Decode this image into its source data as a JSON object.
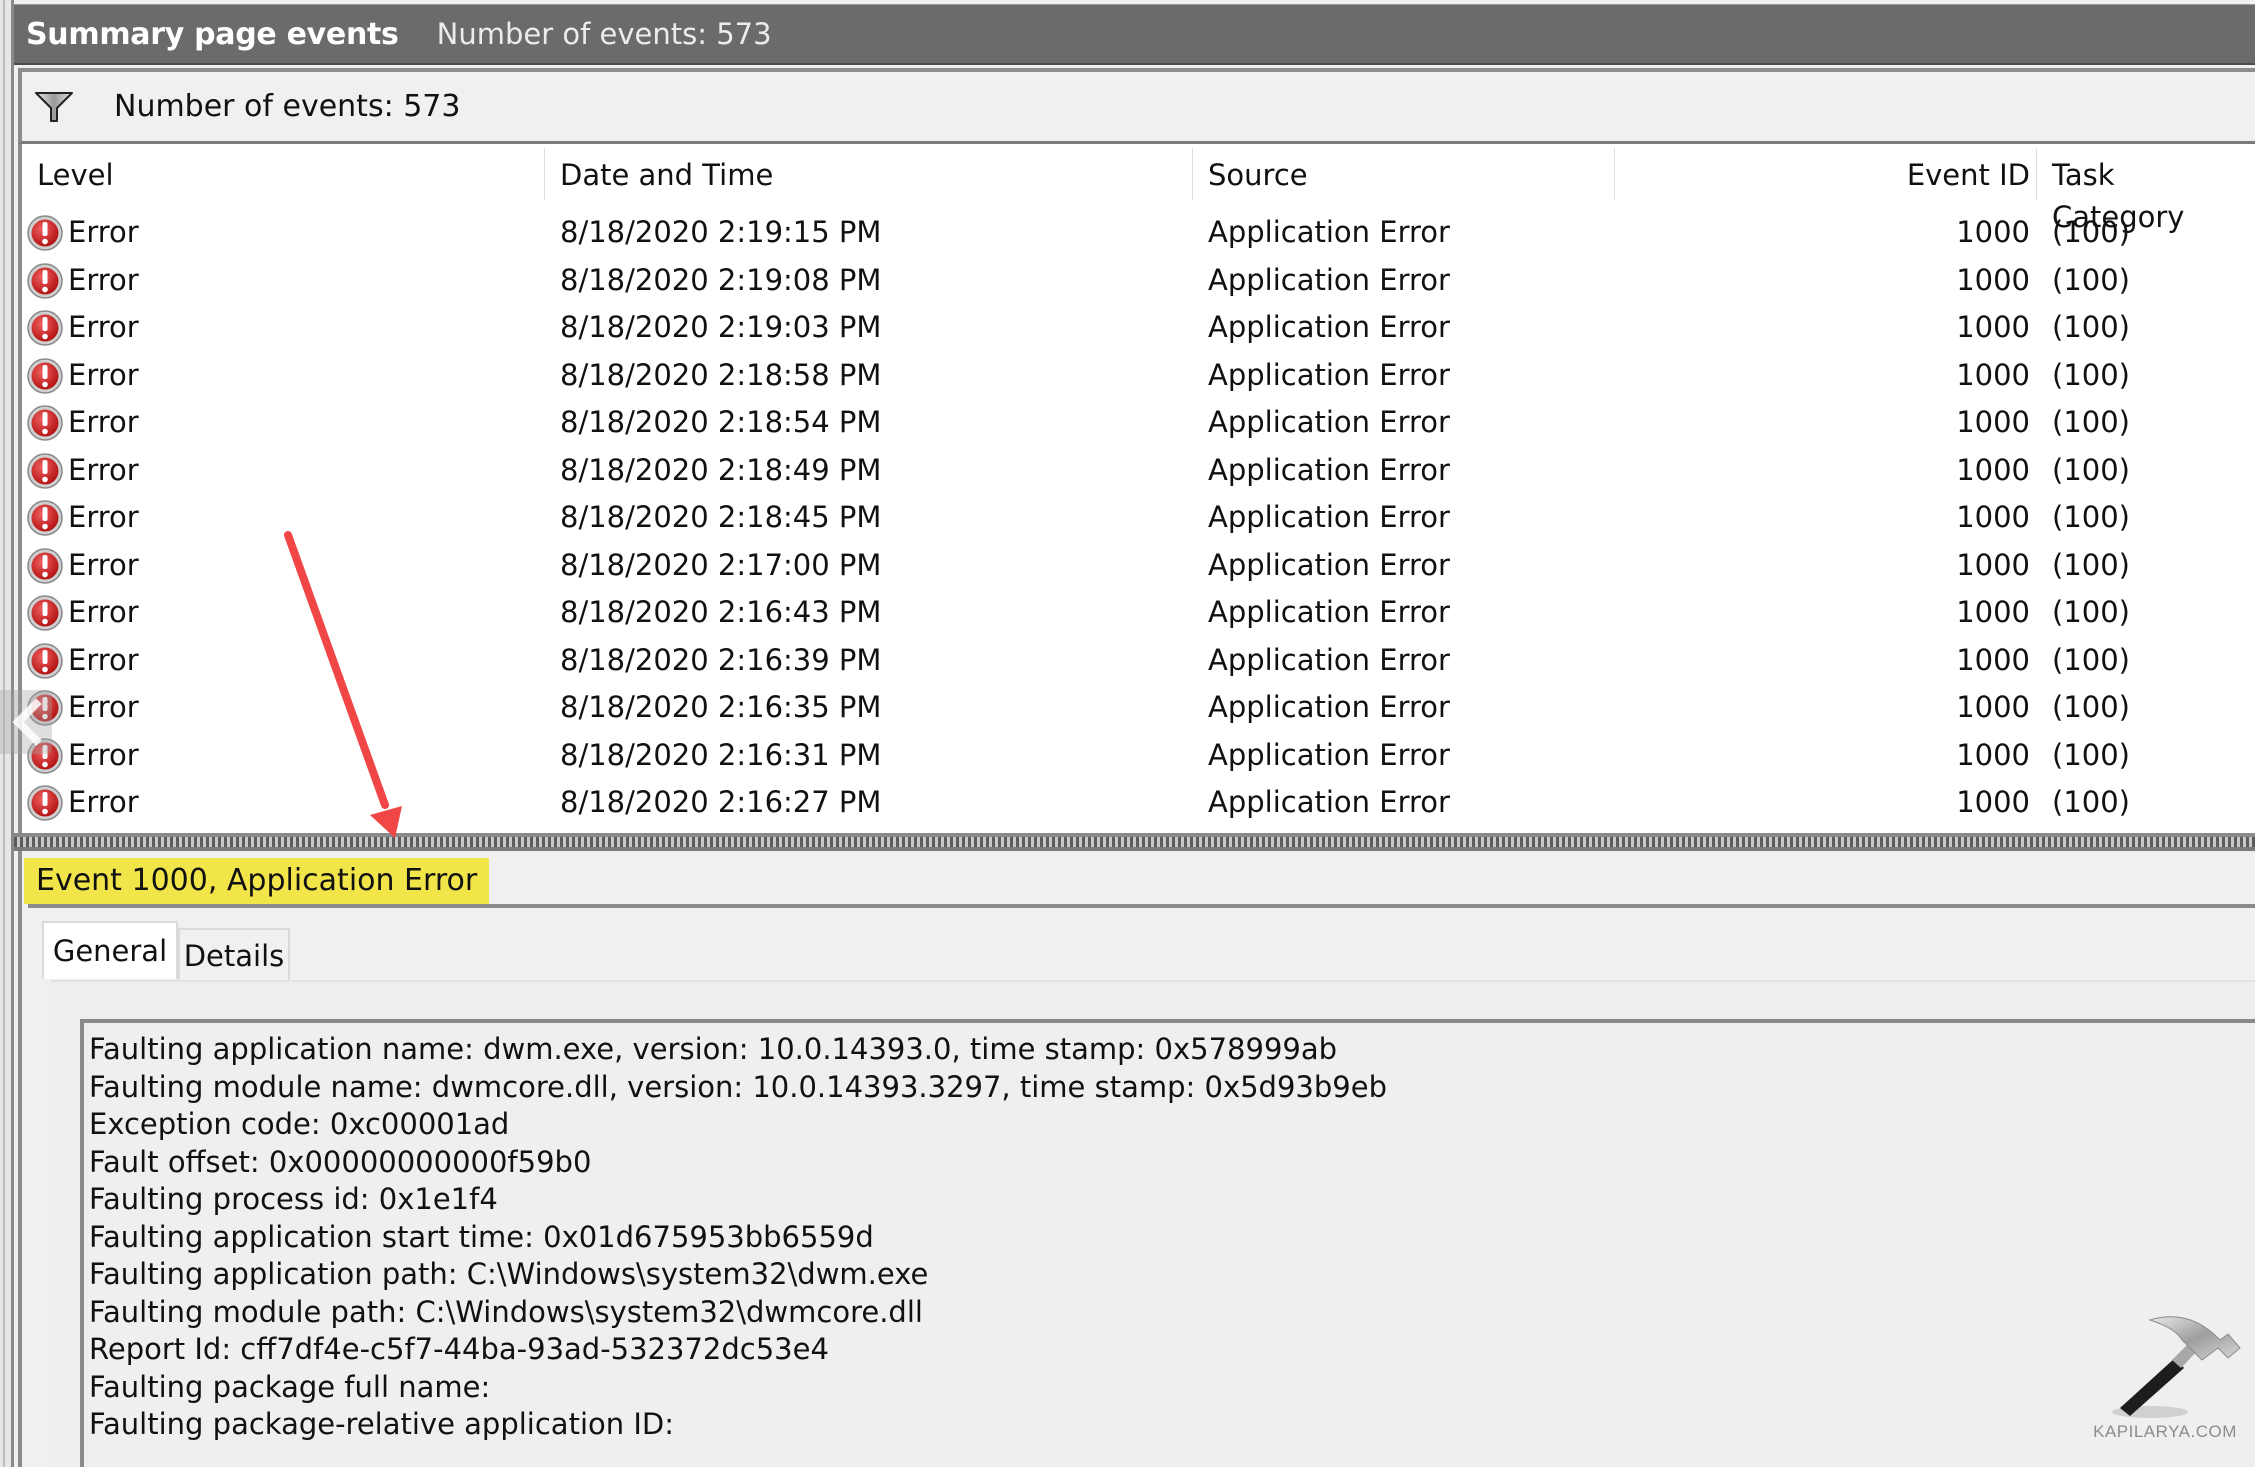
{
  "title_bar": {
    "title": "Summary page events",
    "count_text": "Number of events: 573"
  },
  "filter_bar": {
    "icon": "filter-icon",
    "count_text": "Number of events: 573"
  },
  "grid": {
    "columns": [
      "Level",
      "Date and Time",
      "Source",
      "Event ID",
      "Task Category"
    ],
    "rows": [
      {
        "level": "Error",
        "datetime": "8/18/2020 2:19:15 PM",
        "source": "Application Error",
        "event_id": "1000",
        "task_category": "(100)"
      },
      {
        "level": "Error",
        "datetime": "8/18/2020 2:19:08 PM",
        "source": "Application Error",
        "event_id": "1000",
        "task_category": "(100)"
      },
      {
        "level": "Error",
        "datetime": "8/18/2020 2:19:03 PM",
        "source": "Application Error",
        "event_id": "1000",
        "task_category": "(100)"
      },
      {
        "level": "Error",
        "datetime": "8/18/2020 2:18:58 PM",
        "source": "Application Error",
        "event_id": "1000",
        "task_category": "(100)"
      },
      {
        "level": "Error",
        "datetime": "8/18/2020 2:18:54 PM",
        "source": "Application Error",
        "event_id": "1000",
        "task_category": "(100)"
      },
      {
        "level": "Error",
        "datetime": "8/18/2020 2:18:49 PM",
        "source": "Application Error",
        "event_id": "1000",
        "task_category": "(100)"
      },
      {
        "level": "Error",
        "datetime": "8/18/2020 2:18:45 PM",
        "source": "Application Error",
        "event_id": "1000",
        "task_category": "(100)"
      },
      {
        "level": "Error",
        "datetime": "8/18/2020 2:17:00 PM",
        "source": "Application Error",
        "event_id": "1000",
        "task_category": "(100)"
      },
      {
        "level": "Error",
        "datetime": "8/18/2020 2:16:43 PM",
        "source": "Application Error",
        "event_id": "1000",
        "task_category": "(100)"
      },
      {
        "level": "Error",
        "datetime": "8/18/2020 2:16:39 PM",
        "source": "Application Error",
        "event_id": "1000",
        "task_category": "(100)"
      },
      {
        "level": "Error",
        "datetime": "8/18/2020 2:16:35 PM",
        "source": "Application Error",
        "event_id": "1000",
        "task_category": "(100)"
      },
      {
        "level": "Error",
        "datetime": "8/18/2020 2:16:31 PM",
        "source": "Application Error",
        "event_id": "1000",
        "task_category": "(100)"
      },
      {
        "level": "Error",
        "datetime": "8/18/2020 2:16:27 PM",
        "source": "Application Error",
        "event_id": "1000",
        "task_category": "(100)"
      }
    ]
  },
  "detail": {
    "event_title": "Event 1000, Application Error",
    "highlight_color": "#f1e54a",
    "tabs": [
      {
        "label": "General",
        "active": true
      },
      {
        "label": "Details",
        "active": false
      }
    ],
    "description_lines": [
      "Faulting application name: dwm.exe, version: 10.0.14393.0, time stamp: 0x578999ab",
      "Faulting module name: dwmcore.dll, version: 10.0.14393.3297, time stamp: 0x5d93b9eb",
      "Exception code: 0xc00001ad",
      "Fault offset: 0x00000000000f59b0",
      "Faulting process id: 0x1e1f4",
      "Faulting application start time: 0x01d675953bb6559d",
      "Faulting application path: C:\\Windows\\system32\\dwm.exe",
      "Faulting module path: C:\\Windows\\system32\\dwmcore.dll",
      "Report Id: cff7df4e-c5f7-44ba-93ad-532372dc53e4",
      "Faulting package full name:",
      "Faulting package-relative application ID:"
    ]
  },
  "annotation": {
    "arrow_color": "#f04646",
    "icon": "red-arrow-annotation"
  },
  "watermark": {
    "text": "KAPILARYA.COM",
    "icon": "hammer-icon"
  }
}
